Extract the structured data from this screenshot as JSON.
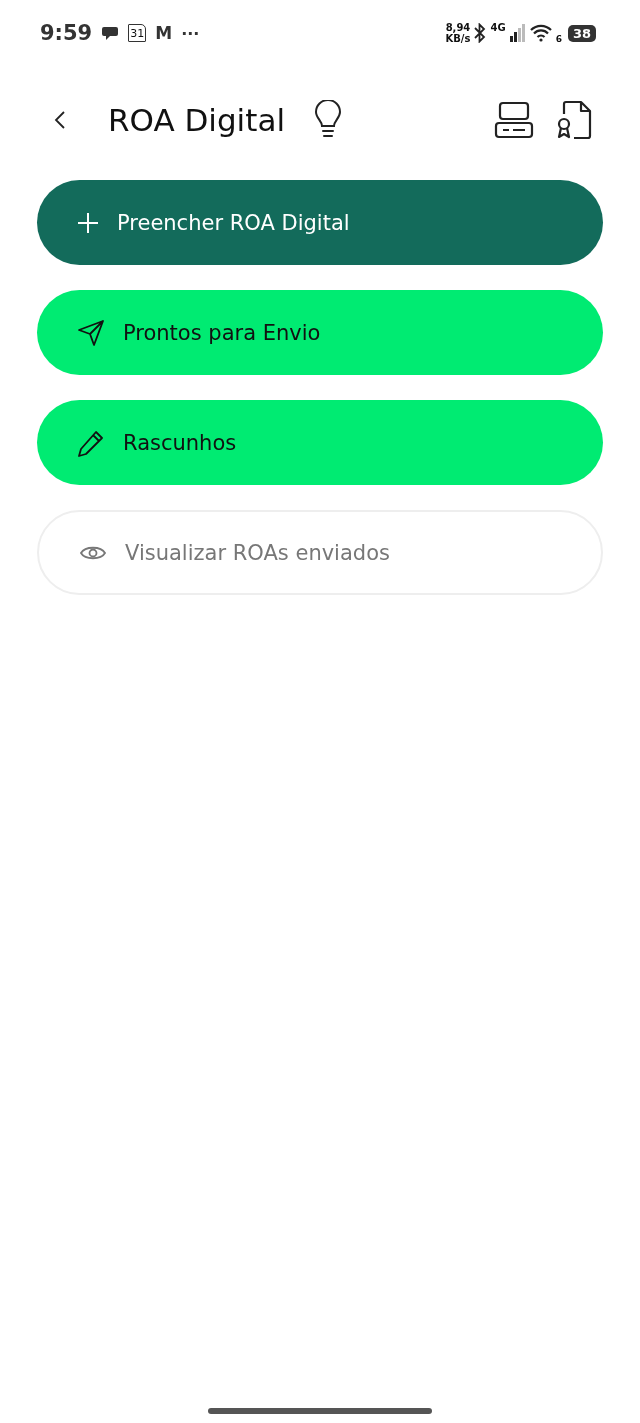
{
  "status_bar": {
    "time": "9:59",
    "calendar_day": "31",
    "mail_letter": "M",
    "more": "···",
    "speed_value": "8,94",
    "speed_unit": "KB/s",
    "network": "4G",
    "wifi_number": "6",
    "battery": "38"
  },
  "header": {
    "title": "ROA Digital"
  },
  "buttons": [
    {
      "kind": "add",
      "label": "Preencher ROA Digital"
    },
    {
      "kind": "send",
      "label": "Prontos para Envio"
    },
    {
      "kind": "edit",
      "label": "Rascunhos"
    },
    {
      "kind": "view",
      "label": "Visualizar ROAs enviados"
    }
  ]
}
